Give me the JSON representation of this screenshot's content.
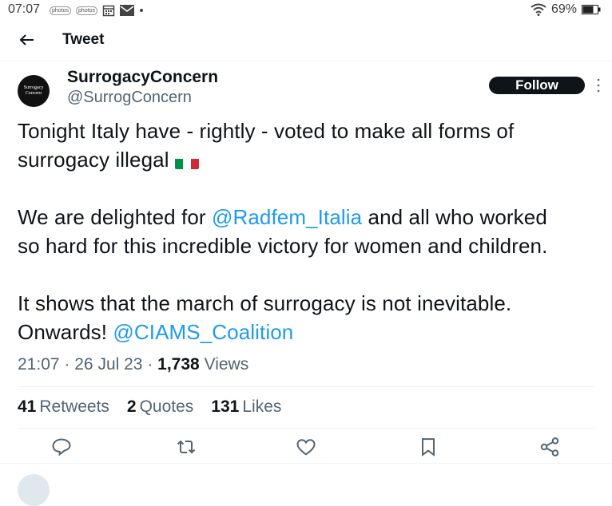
{
  "status_bar": {
    "time": "07:07",
    "notif_icons": [
      "photos-icon",
      "photos-icon",
      "calendar-icon",
      "mail-icon",
      "dot-icon"
    ],
    "notif_labels": [
      "photos",
      "photos"
    ],
    "battery_percent": "69%"
  },
  "header": {
    "title": "Tweet"
  },
  "tweet": {
    "avatar_text": "Surrogacy Concern",
    "author_name": "SurrogacyConcern",
    "author_handle": "@SurrogConcern",
    "follow_label": "Follow",
    "line1": "Tonight Italy have - rightly - voted to make all forms of",
    "line2": "surrogacy illegal ",
    "flag_colors": [
      "#009246",
      "#ffffff",
      "#ce2b37"
    ],
    "p2_pre": "We are delighted for ",
    "p2_mention": "@Radfem_Italia",
    "p2_post": " and all who worked",
    "p2_line2": "so hard for this incredible victory for women and children.",
    "p3_line1": "It shows that the march of surrogacy is not inevitable.",
    "p3_pre": "Onwards! ",
    "p3_mention": "@CIAMS_Coalition",
    "time": "21:07",
    "date": "26 Jul 23",
    "views_count": "1,738",
    "views_label": "Views"
  },
  "stats": {
    "retweets_count": "41",
    "retweets_label": "Retweets",
    "quotes_count": "2",
    "quotes_label": "Quotes",
    "likes_count": "131",
    "likes_label": "Likes"
  },
  "actions": [
    "reply-icon",
    "retweet-icon",
    "like-icon",
    "bookmark-icon",
    "share-icon"
  ],
  "colors": {
    "link": "#1d9bf0",
    "secondary_text": "#536471",
    "primary_text": "#0f1419",
    "divider": "#eff3f4"
  }
}
